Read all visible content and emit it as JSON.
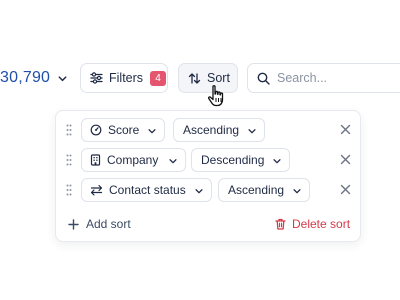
{
  "toolbar": {
    "record_count": "30,790",
    "filters_label": "Filters",
    "filters_count": "4",
    "sort_label": "Sort",
    "search_placeholder": "Search..."
  },
  "sort_panel": {
    "rules": [
      {
        "field": "Score",
        "field_icon": "gauge-icon",
        "direction": "Ascending"
      },
      {
        "field": "Company",
        "field_icon": "building-icon",
        "direction": "Descending"
      },
      {
        "field": "Contact status",
        "field_icon": "status-arrows-icon",
        "direction": "Ascending"
      }
    ],
    "add_sort_label": "Add sort",
    "delete_sort_label": "Delete sort"
  },
  "colors": {
    "accent_blue": "#1f4fa8",
    "badge_red": "#e4566f",
    "danger_red": "#d43a48",
    "border": "#dfe3ea"
  }
}
